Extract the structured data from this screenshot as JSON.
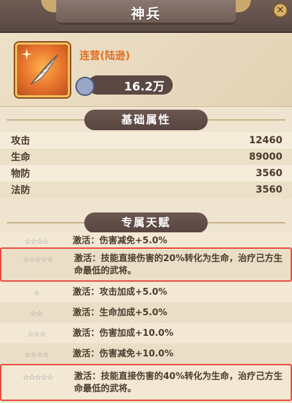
{
  "header": {
    "title": "神兵"
  },
  "weapon": {
    "name": "连营(陆逊)",
    "power": "16.2万",
    "icon": "feather-icon"
  },
  "sections": {
    "base_stats": "基础属性",
    "talents": "专属天赋"
  },
  "stats": [
    {
      "label": "攻击",
      "value": "12460"
    },
    {
      "label": "生命",
      "value": "89000"
    },
    {
      "label": "物防",
      "value": "3560"
    },
    {
      "label": "法防",
      "value": "3560"
    }
  ],
  "talents": [
    {
      "stars": "☆☆☆☆",
      "text": "激活：伤害减免+5.0%"
    },
    {
      "stars": "☆☆☆☆☆",
      "text": "激活：技能直接伤害的20%转化为生命，治疗己方生命最低的武将。"
    },
    {
      "stars": "☆",
      "text": "激活：攻击加成+5.0%"
    },
    {
      "stars": "☆☆",
      "text": "激活：生命加成+5.0%"
    },
    {
      "stars": "☆☆☆",
      "text": "激活：伤害加成+10.0%"
    },
    {
      "stars": "☆☆☆☆",
      "text": "激活：伤害减免+10.0%"
    },
    {
      "stars": "☆☆☆☆☆",
      "text": "激活：技能直接伤害的40%转化为生命，治疗己方生命最低的武将。"
    }
  ],
  "colors": {
    "accent": "#e26d1f",
    "highlight_border": "#e8483c",
    "ribbon": "#5f4b45"
  }
}
